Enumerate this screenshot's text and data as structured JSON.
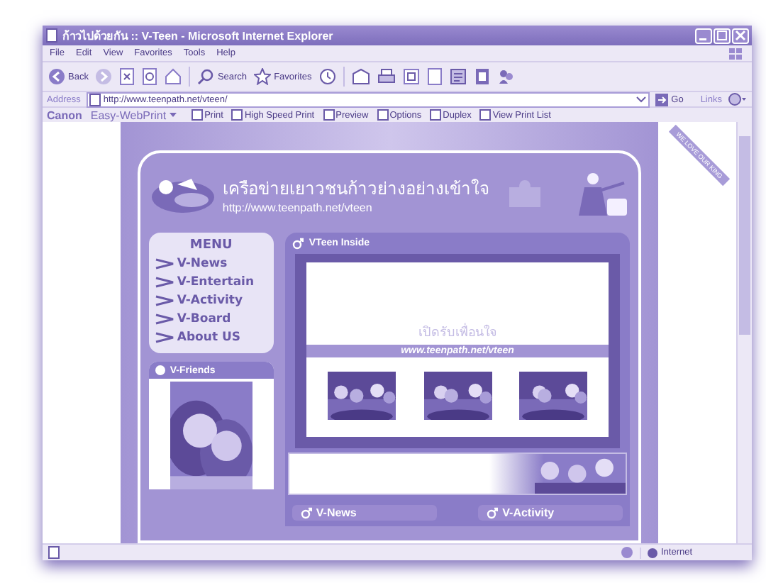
{
  "window": {
    "title": "ก้าวไปด้วยกัน :: V-Teen - Microsoft Internet Explorer"
  },
  "menu_bar": [
    "File",
    "Edit",
    "View",
    "Favorites",
    "Tools",
    "Help"
  ],
  "toolbar": {
    "back": "Back",
    "search": "Search",
    "favorites": "Favorites"
  },
  "address_bar": {
    "label": "Address",
    "value": "http://www.teenpath.net/vteen/",
    "go": "Go",
    "links": "Links"
  },
  "print_bar": {
    "brand": "Canon",
    "product": "Easy-WebPrint",
    "buttons": [
      "Print",
      "High Speed Print",
      "Preview",
      "Options",
      "Duplex",
      "View Print List"
    ]
  },
  "page": {
    "ribbon": "WE LOVE OUR KING",
    "tagline": "เครือข่ายเยาวชนก้าวย่างอย่างเข้าใจ",
    "url": "http://www.teenpath.net/vteen",
    "menu_title": "MENU",
    "menu": [
      "V-News",
      "V-Entertain",
      "V-Activity",
      "V-Board",
      "About US"
    ],
    "friends_title": "V-Friends",
    "inside_title": "VTeen Inside",
    "inside_caption": "เปิดรับเพื่อนใจ",
    "inside_url": "www.teenpath.net/vteen",
    "sections": [
      "V-News",
      "V-Activity"
    ]
  },
  "status_bar": {
    "zone": "Internet"
  }
}
